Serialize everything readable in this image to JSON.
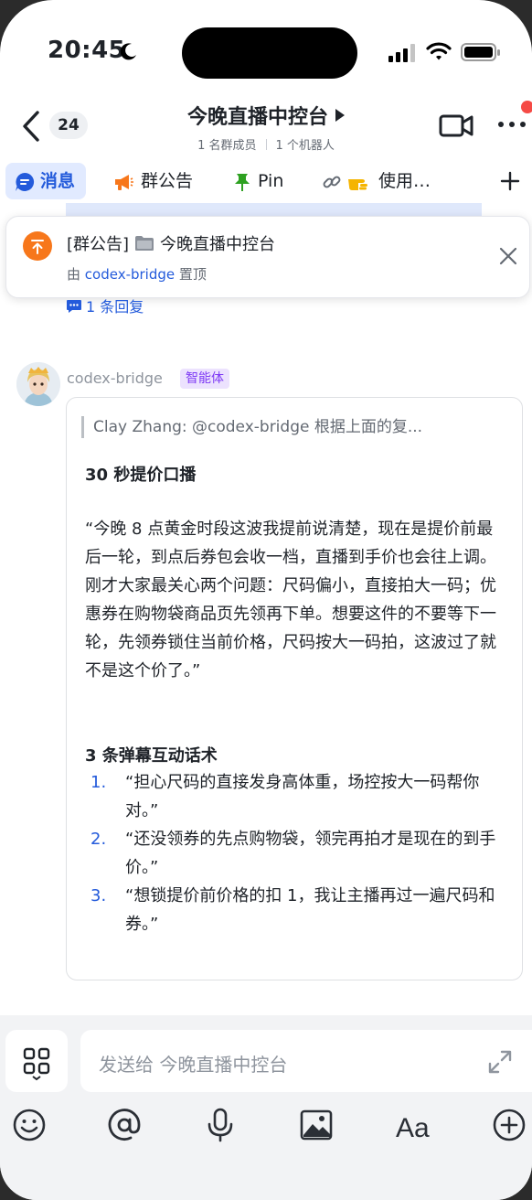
{
  "status_bar": {
    "time": "20:45"
  },
  "header": {
    "back_count": "24",
    "title": "今晚直播中控台",
    "members": "1 名群成员",
    "bots": "1 个机器人"
  },
  "tabs": [
    {
      "label": "消息",
      "icon": "message-icon",
      "active": true
    },
    {
      "label": "群公告",
      "icon": "megaphone-icon",
      "active": false
    },
    {
      "label": "Pin",
      "icon": "pin-icon",
      "active": false
    },
    {
      "label": "使用…",
      "icon": "link-hand-icon",
      "active": false
    }
  ],
  "pinned": {
    "title_prefix": "[群公告]",
    "title": "今晚直播中控台",
    "by_prefix": "由",
    "by_user": "codex-bridge",
    "by_suffix": "置顶"
  },
  "reply_count": "1 条回复",
  "message": {
    "sender": "codex-bridge",
    "tag": "智能体",
    "quote": "Clay Zhang: @codex-bridge  根据上面的复...",
    "heading1": "30 秒提价口播",
    "paragraph": "“今晚 8 点黄金时段这波我提前说清楚，现在是提价前最后一轮，到点后券包会收一档，直播到手价也会往上调。刚才大家最关心两个问题：尺码偏小，直接拍大一码；优惠券在购物袋商品页先领再下单。想要这件的不要等下一轮，先领券锁住当前价格，尺码按大一码拍，这波过了就不是这个价了。”",
    "heading2": "3 条弹幕互动话术",
    "list": [
      {
        "num": "1.",
        "text": "“担心尺码的直接发身高体重，场控按大一码帮你对。”"
      },
      {
        "num": "2.",
        "text": "“还没领券的先点购物袋，领完再拍才是现在的到手价。”"
      },
      {
        "num": "3.",
        "text": "“想锁提价前价格的扣 1，我让主播再过一遍尺码和券。”"
      }
    ]
  },
  "input": {
    "placeholder": "发送给 今晚直播中控台"
  },
  "colors": {
    "accent": "#245bdb",
    "tag_bg": "#ece2fe",
    "tag_text": "#7f3bf5",
    "pin_orange": "#f7771b",
    "notify_red": "#f54a45"
  }
}
